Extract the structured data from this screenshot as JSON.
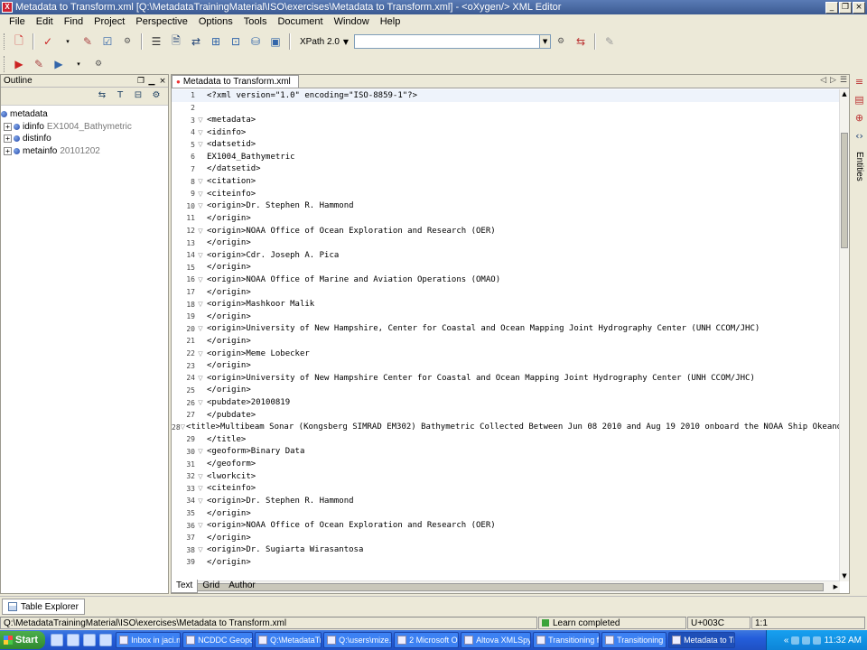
{
  "window": {
    "title": "Metadata to Transform.xml [Q:\\MetadataTrainingMaterial\\ISO\\exercises\\Metadata to Transform.xml] - <oXygen/> XML Editor",
    "app_icon": "oxygen-icon"
  },
  "menu": [
    "File",
    "Edit",
    "Find",
    "Project",
    "Perspective",
    "Options",
    "Tools",
    "Document",
    "Window",
    "Help"
  ],
  "xpath": {
    "version": "XPath 2.0",
    "value": ""
  },
  "outline": {
    "title": "Outline",
    "root": "metadata",
    "children": [
      {
        "name": "idinfo",
        "extra": "EX1004_Bathymetric"
      },
      {
        "name": "distinfo",
        "extra": ""
      },
      {
        "name": "metainfo",
        "extra": "20101202"
      }
    ]
  },
  "editor": {
    "tab_label": "Metadata to Transform.xml",
    "lines": [
      {
        "n": "1",
        "code": "<?xml version=\"1.0\" encoding=\"ISO-8859-1\"?>"
      },
      {
        "n": "2",
        "code": ""
      },
      {
        "n": "3",
        "code": "<metadata>"
      },
      {
        "n": "4",
        "code": "<idinfo>"
      },
      {
        "n": "5",
        "code": "<datsetid>"
      },
      {
        "n": "6",
        "code": "EX1004_Bathymetric"
      },
      {
        "n": "7",
        "code": "</datsetid>"
      },
      {
        "n": "8",
        "code": "<citation>"
      },
      {
        "n": "9",
        "code": "<citeinfo>"
      },
      {
        "n": "10",
        "code": "<origin>Dr. Stephen R. Hammond"
      },
      {
        "n": "11",
        "code": "</origin>"
      },
      {
        "n": "12",
        "code": "<origin>NOAA Office of Ocean Exploration and Research (OER)"
      },
      {
        "n": "13",
        "code": "</origin>"
      },
      {
        "n": "14",
        "code": "<origin>Cdr. Joseph A. Pica"
      },
      {
        "n": "15",
        "code": "</origin>"
      },
      {
        "n": "16",
        "code": "<origin>NOAA Office of Marine and Aviation Operations (OMAO)"
      },
      {
        "n": "17",
        "code": "</origin>"
      },
      {
        "n": "18",
        "code": "<origin>Mashkoor Malik"
      },
      {
        "n": "19",
        "code": "</origin>"
      },
      {
        "n": "20",
        "code": "<origin>University of New Hampshire, Center for Coastal and Ocean Mapping Joint Hydrography Center (UNH CCOM/JHC)"
      },
      {
        "n": "21",
        "code": "</origin>"
      },
      {
        "n": "22",
        "code": "<origin>Meme Lobecker"
      },
      {
        "n": "23",
        "code": "</origin>"
      },
      {
        "n": "24",
        "code": "<origin>University of New Hampshire Center for Coastal and Ocean Mapping Joint Hydrography Center (UNH CCOM/JHC)"
      },
      {
        "n": "25",
        "code": "</origin>"
      },
      {
        "n": "26",
        "code": "<pubdate>20100819"
      },
      {
        "n": "27",
        "code": "</pubdate>"
      },
      {
        "n": "28",
        "code": "<title>Multibeam Sonar (Kongsberg SIMRAD EM302) Bathymetric Collected Between Jun 08 2010 and Aug 19 2010 onboard the NOAA Ship Okeanos Explorer duri"
      },
      {
        "n": "29",
        "code": "</title>"
      },
      {
        "n": "30",
        "code": "<geoform>Binary Data"
      },
      {
        "n": "31",
        "code": "</geoform>"
      },
      {
        "n": "32",
        "code": "<lworkcit>"
      },
      {
        "n": "33",
        "code": "<citeinfo>"
      },
      {
        "n": "34",
        "code": "<origin>Dr. Stephen R. Hammond"
      },
      {
        "n": "35",
        "code": "</origin>"
      },
      {
        "n": "36",
        "code": "<origin>NOAA Office of Ocean Exploration and Research (OER)"
      },
      {
        "n": "37",
        "code": "</origin>"
      },
      {
        "n": "38",
        "code": "<origin>Dr. Sugiarta Wirasantosa"
      },
      {
        "n": "39",
        "code": "</origin>"
      }
    ],
    "mode_tabs": [
      "Text",
      "Grid",
      "Author"
    ]
  },
  "side_panel": {
    "entities_label": "Entities"
  },
  "bottom_panel": {
    "tab_label": "Table Explorer"
  },
  "status": {
    "path": "Q:\\MetadataTrainingMaterial\\ISO\\exercises\\Metadata to Transform.xml",
    "message": "Learn completed",
    "unicode": "U+003C",
    "position": "1:1"
  },
  "taskbar": {
    "start_label": "Start",
    "tasks": [
      {
        "label": "Inbox in jaci.mi...",
        "icon": "mail-icon"
      },
      {
        "label": "NCDDC Geopo...",
        "icon": "browser-icon"
      },
      {
        "label": "Q:\\MetadataTr...",
        "icon": "folder-icon"
      },
      {
        "label": "Q:\\users\\mize...",
        "icon": "folder-icon"
      },
      {
        "label": "2 Microsoft O...",
        "icon": "word-icon"
      },
      {
        "label": "Altova XMLSpy...",
        "icon": "xmlspy-icon"
      },
      {
        "label": "Transitioning fr...",
        "icon": "document-icon"
      },
      {
        "label": "Transitioning fr...",
        "icon": "document-icon"
      },
      {
        "label": "Metadata to Tr...",
        "icon": "oxygen-icon"
      }
    ],
    "clock": "11:32 AM"
  },
  "colors": {
    "titlebar": "#3b5a92",
    "taskbar": "#245edb",
    "start": "#2f8a2f",
    "status_ok": "#3ba43b"
  }
}
